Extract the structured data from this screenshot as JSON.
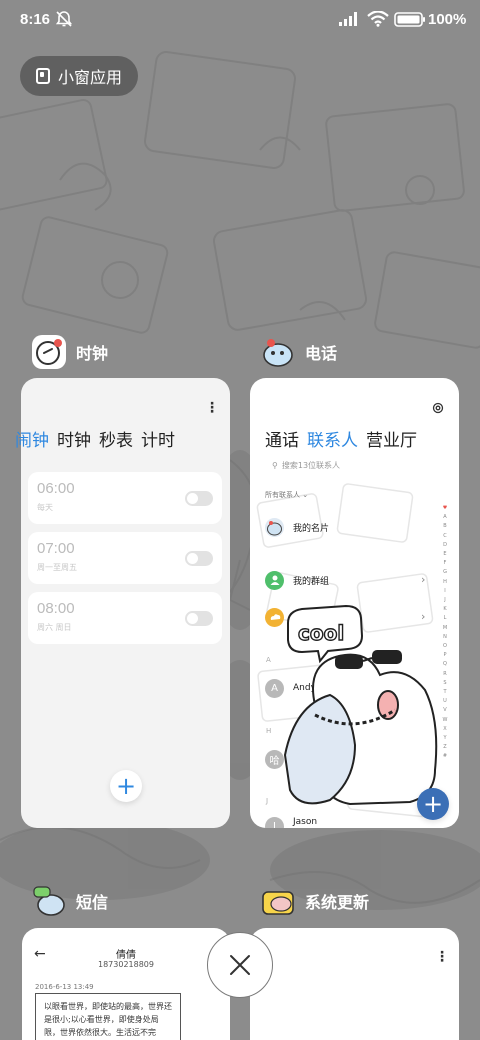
{
  "status_bar": {
    "time": "8:16",
    "battery_percent": "100%"
  },
  "small_window_label": "小窗应用",
  "clock_app": {
    "name": "时钟",
    "tabs": [
      "闹钟",
      "时钟",
      "秒表",
      "计时"
    ],
    "alarms": [
      {
        "time": "06:00",
        "repeat": "每天"
      },
      {
        "time": "07:00",
        "repeat": "周一至周五"
      },
      {
        "time": "08:00",
        "repeat": "周六 周日"
      }
    ]
  },
  "phone_app": {
    "name": "电话",
    "tabs": [
      "通话",
      "联系人",
      "营业厅"
    ],
    "search_placeholder": "搜索13位联系人",
    "all_contacts_label": "所有联系人",
    "contacts": [
      {
        "label": "我的名片"
      },
      {
        "label": "我的群组"
      },
      {
        "label": "黄页"
      }
    ],
    "letters": [
      "A",
      "H",
      "J"
    ],
    "entries": [
      {
        "initial": "A",
        "name": "Andy"
      },
      {
        "initial": "哈",
        "name": "哈哈"
      },
      {
        "initial": "J",
        "name": "Jason"
      }
    ],
    "az_index": [
      "♥",
      "A",
      "B",
      "C",
      "D",
      "E",
      "F",
      "G",
      "H",
      "I",
      "J",
      "K",
      "L",
      "M",
      "N",
      "O",
      "P",
      "Q",
      "R",
      "S",
      "T",
      "U",
      "V",
      "W",
      "X",
      "Y",
      "Z",
      "#"
    ],
    "sticker_text": "cool"
  },
  "sms_app": {
    "name": "短信",
    "contact_name": "倩倩",
    "contact_number": "18730218809",
    "date": "2016-6-13 13:49",
    "message": "以眼看世界，即使站的最高，世界还是很小;以心看世界，即使身处局限，世界依然很大。生活远不完"
  },
  "update_app": {
    "name": "系统更新"
  }
}
